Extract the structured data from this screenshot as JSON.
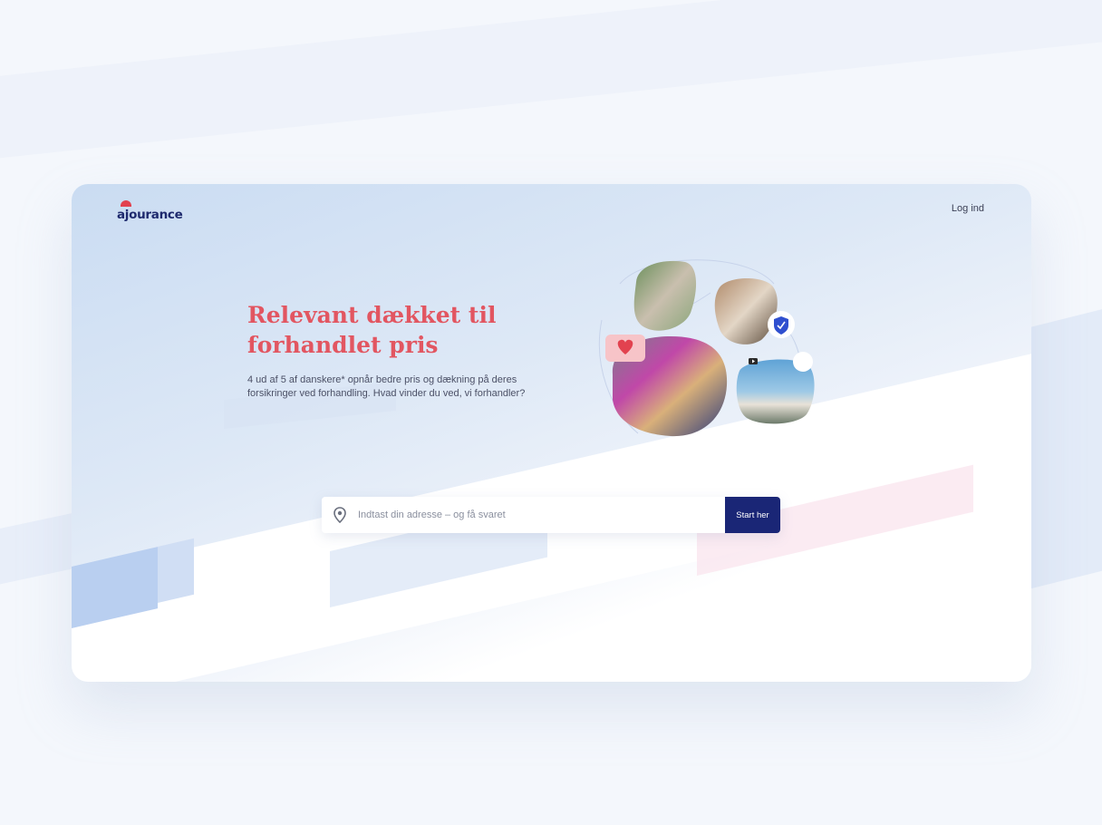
{
  "brand": {
    "logo_text": "ajourance"
  },
  "header": {
    "login_label": "Log ind"
  },
  "hero": {
    "title": "Relevant dækket til forhandlet pris",
    "subtitle": "4 ud af 5 af danskere* opnår bedre pris og dækning på deres forsikringer ved forhandling. Hvad vinder du ved, vi forhandler?"
  },
  "search": {
    "placeholder": "Indtast din adresse – og få svaret",
    "value": "",
    "button_label": "Start her",
    "icon": "location-pin-icon"
  },
  "colors": {
    "accent": "#e25661",
    "brand_navy": "#1a2676",
    "logo_mark": "#e2424f"
  },
  "illustration": {
    "icons": [
      "heart-icon",
      "shield-check-icon",
      "video-icon"
    ]
  }
}
